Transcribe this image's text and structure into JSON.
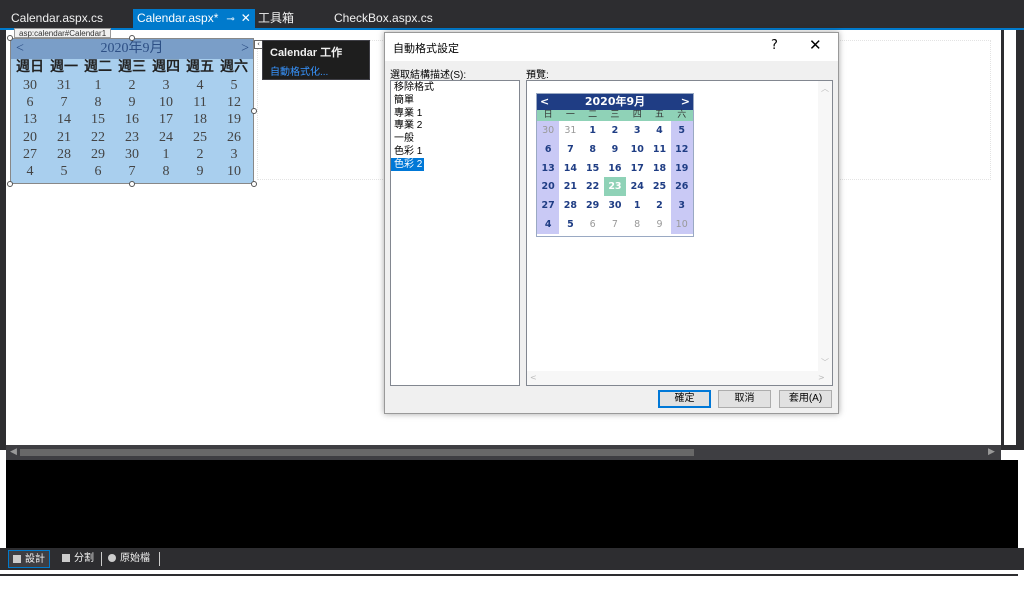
{
  "tabs": [
    {
      "label": "Calendar.aspx.cs",
      "active": false
    },
    {
      "label": "Calendar.aspx*",
      "active": true
    },
    {
      "label": "工具箱",
      "active": false
    },
    {
      "label": "CheckBox.aspx.cs",
      "active": false
    }
  ],
  "designer": {
    "control_tag": "asp:calendar#Calendar1",
    "calendar": {
      "prev": "<",
      "next": ">",
      "title": "2020年9月",
      "dow": [
        "週日",
        "週一",
        "週二",
        "週三",
        "週四",
        "週五",
        "週六"
      ],
      "days": [
        "30",
        "31",
        "1",
        "2",
        "3",
        "4",
        "5",
        "6",
        "7",
        "8",
        "9",
        "10",
        "11",
        "12",
        "13",
        "14",
        "15",
        "16",
        "17",
        "18",
        "19",
        "20",
        "21",
        "22",
        "23",
        "24",
        "25",
        "26",
        "27",
        "28",
        "29",
        "30",
        "1",
        "2",
        "3",
        "4",
        "5",
        "6",
        "7",
        "8",
        "9",
        "10"
      ]
    },
    "smart_tag_arrow": "‹",
    "task_pane": {
      "title": "Calendar 工作",
      "link": "自動格式化..."
    }
  },
  "dialog": {
    "title": "自動格式設定",
    "help": "?",
    "close": "✕",
    "list_label": "選取結構描述(S):",
    "preview_label": "預覽:",
    "schemes": [
      "移除格式",
      "簡單",
      "專業 1",
      "專業 2",
      "一般",
      "色彩 1",
      "色彩 2"
    ],
    "selected_scheme": "色彩 2",
    "preview_calendar": {
      "prev": "<",
      "next": ">",
      "title": "2020年9月",
      "dow": [
        "日",
        "一",
        "二",
        "三",
        "四",
        "五",
        "六"
      ],
      "days": [
        "30",
        "31",
        "1",
        "2",
        "3",
        "4",
        "5",
        "6",
        "7",
        "8",
        "9",
        "10",
        "11",
        "12",
        "13",
        "14",
        "15",
        "16",
        "17",
        "18",
        "19",
        "20",
        "21",
        "22",
        "23",
        "24",
        "25",
        "26",
        "27",
        "28",
        "29",
        "30",
        "1",
        "2",
        "3",
        "4",
        "5",
        "6",
        "7",
        "8",
        "9",
        "10"
      ],
      "other_month_indices": [
        0,
        1,
        37,
        38,
        39,
        40,
        41
      ],
      "today_index": 24,
      "colors": {
        "header": "#1f3d84",
        "dow": "#8fd2b7",
        "weekend": "#c9c9f5",
        "today": "#8fd2b7"
      }
    },
    "buttons": {
      "ok": "確定",
      "cancel": "取消",
      "apply": "套用(A)"
    }
  },
  "bottom_tabs": [
    {
      "label": "設計",
      "active": true
    },
    {
      "label": "分割",
      "active": false
    },
    {
      "label": "原始檔",
      "active": false
    }
  ],
  "icons": {
    "pin": "pin-icon",
    "close": "close-icon"
  }
}
